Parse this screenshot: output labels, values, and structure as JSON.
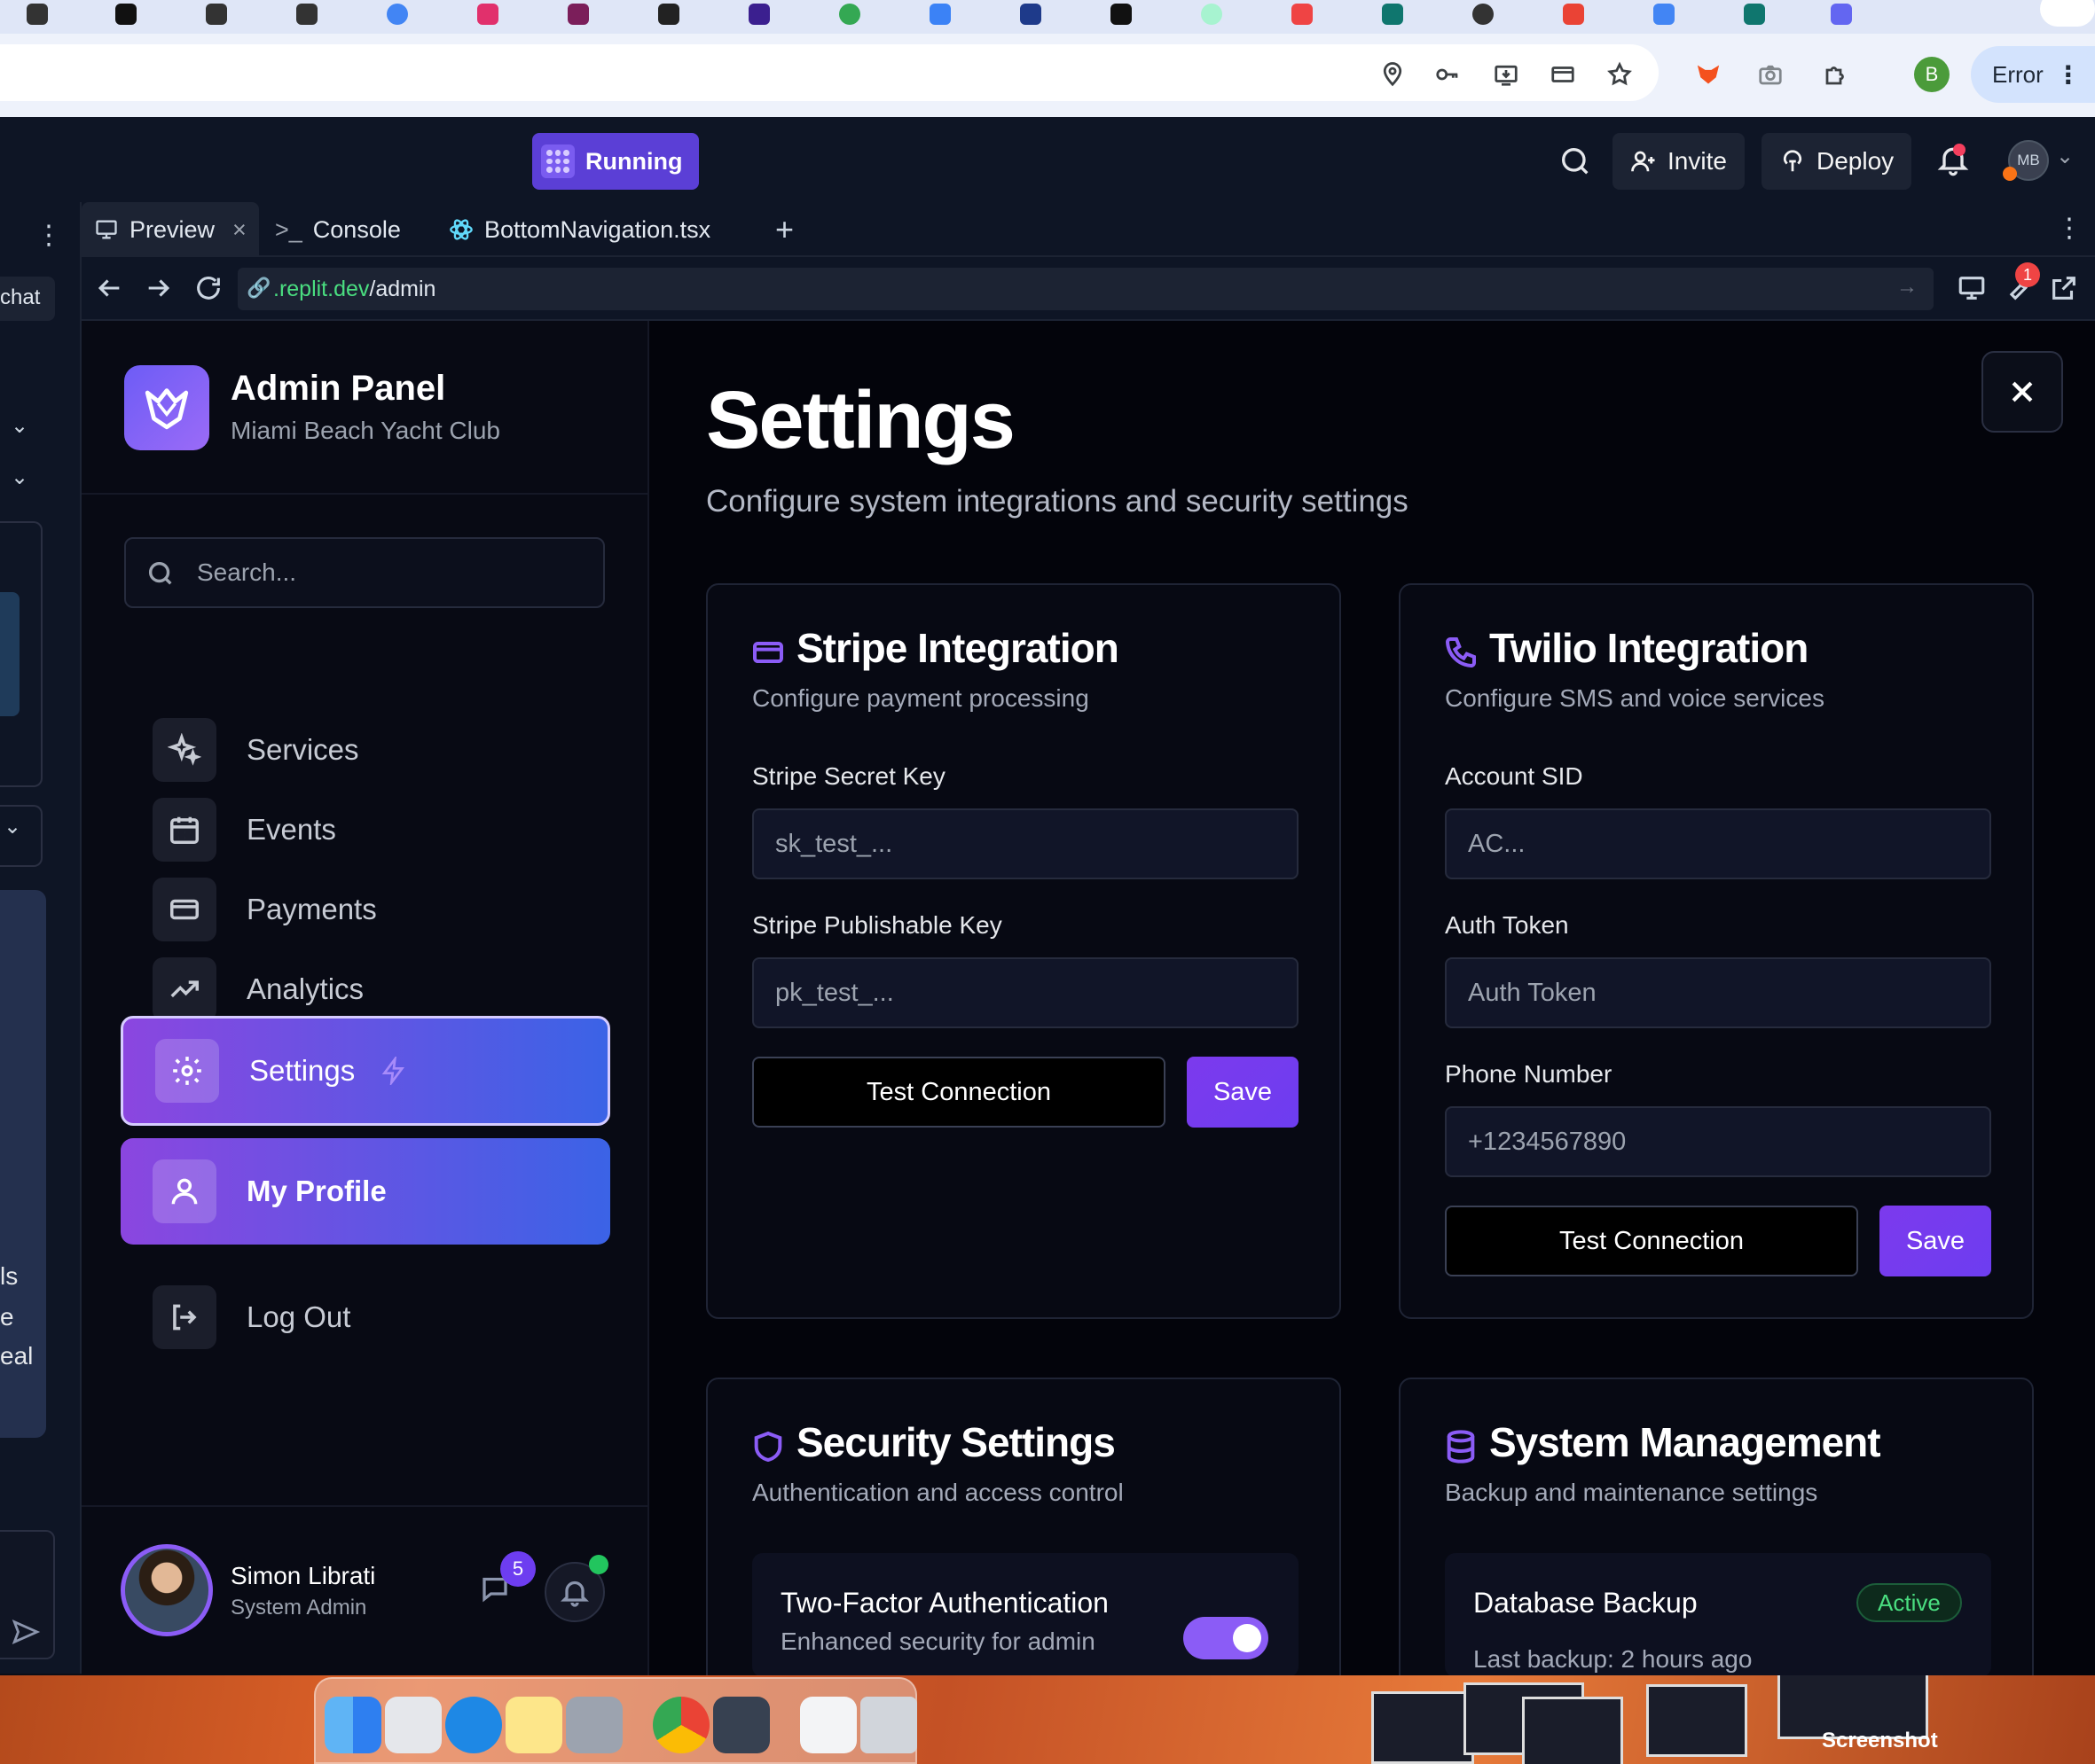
{
  "browser": {
    "error_label": "Error",
    "profile_letter": "B",
    "toolbar_icons": [
      "location-pin-icon",
      "key-icon",
      "install-icon",
      "card-icon",
      "star-icon",
      "extension-fox-icon",
      "camera-icon",
      "puzzle-icon"
    ]
  },
  "replit": {
    "running_label": "Running",
    "invite_label": "Invite",
    "deploy_label": "Deploy",
    "avatar_initials": "MB",
    "left_pane_snippets": [
      "chat",
      "ls",
      "e",
      "eal"
    ],
    "tabs": [
      {
        "label": "Preview"
      },
      {
        "label": "Console"
      },
      {
        "label": "BottomNavigation.tsx"
      }
    ],
    "url": {
      "host": ".replit.dev",
      "path": "/admin"
    },
    "wrench_badge": "1"
  },
  "sidebar": {
    "brand_title": "Admin Panel",
    "brand_subtitle": "Miami Beach Yacht Club",
    "search_placeholder": "Search...",
    "items": [
      {
        "label": "Services"
      },
      {
        "label": "Events"
      },
      {
        "label": "Payments"
      },
      {
        "label": "Analytics"
      },
      {
        "label": "Settings"
      },
      {
        "label": "My Profile"
      },
      {
        "label": "Log Out"
      }
    ],
    "user": {
      "name": "Simon Librati",
      "role": "System Admin",
      "message_count": "5"
    }
  },
  "main": {
    "title": "Settings",
    "subtitle": "Configure system integrations and security settings",
    "stripe": {
      "title": "Stripe Integration",
      "subtitle": "Configure payment processing",
      "secret_label": "Stripe Secret Key",
      "secret_placeholder": "sk_test_...",
      "publishable_label": "Stripe Publishable Key",
      "publishable_placeholder": "pk_test_...",
      "test_label": "Test Connection",
      "save_label": "Save"
    },
    "twilio": {
      "title": "Twilio Integration",
      "subtitle": "Configure SMS and voice services",
      "sid_label": "Account SID",
      "sid_placeholder": "AC...",
      "token_label": "Auth Token",
      "token_placeholder": "Auth Token",
      "phone_label": "Phone Number",
      "phone_placeholder": "+1234567890",
      "test_label": "Test Connection",
      "save_label": "Save"
    },
    "security": {
      "title": "Security Settings",
      "subtitle": "Authentication and access control",
      "twofa_title": "Two-Factor Authentication",
      "twofa_desc": "Enhanced security for admin",
      "twofa_enabled": true
    },
    "system": {
      "title": "System Management",
      "subtitle": "Backup and maintenance settings",
      "backup_title": "Database Backup",
      "backup_status": "Active",
      "backup_last": "Last backup: 2 hours ago"
    }
  },
  "dock": {
    "thumbnail_caption": "Screenshot"
  },
  "colors": {
    "accent_purple": "#8b5cf6",
    "accent_blue": "#3b63e6",
    "running": "#5b3fd6",
    "success": "#4ade80"
  }
}
